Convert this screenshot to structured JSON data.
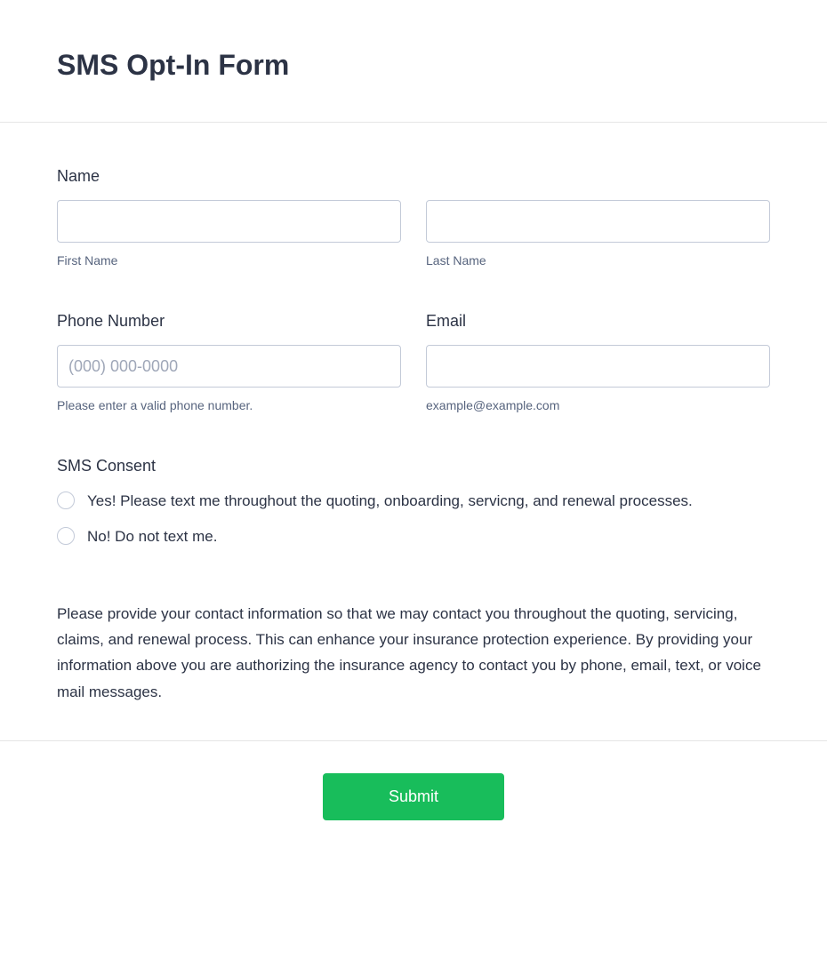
{
  "title": "SMS Opt-In Form",
  "name": {
    "label": "Name",
    "first_sublabel": "First Name",
    "last_sublabel": "Last Name"
  },
  "phone": {
    "label": "Phone Number",
    "placeholder": "(000) 000-0000",
    "sublabel": "Please enter a valid phone number."
  },
  "email": {
    "label": "Email",
    "sublabel": "example@example.com"
  },
  "consent": {
    "label": "SMS Consent",
    "option_yes": "Yes! Please text me throughout the quoting, onboarding, servicng, and renewal processes.",
    "option_no": "No! Do not text me."
  },
  "disclosure": "Please provide your contact information so that we may contact you throughout the quoting, servicing, claims, and renewal process. This can enhance your insurance protection experience. By providing your information above you are authorizing the insurance agency to contact you by phone, email, text, or voice mail messages.",
  "submit_label": "Submit"
}
